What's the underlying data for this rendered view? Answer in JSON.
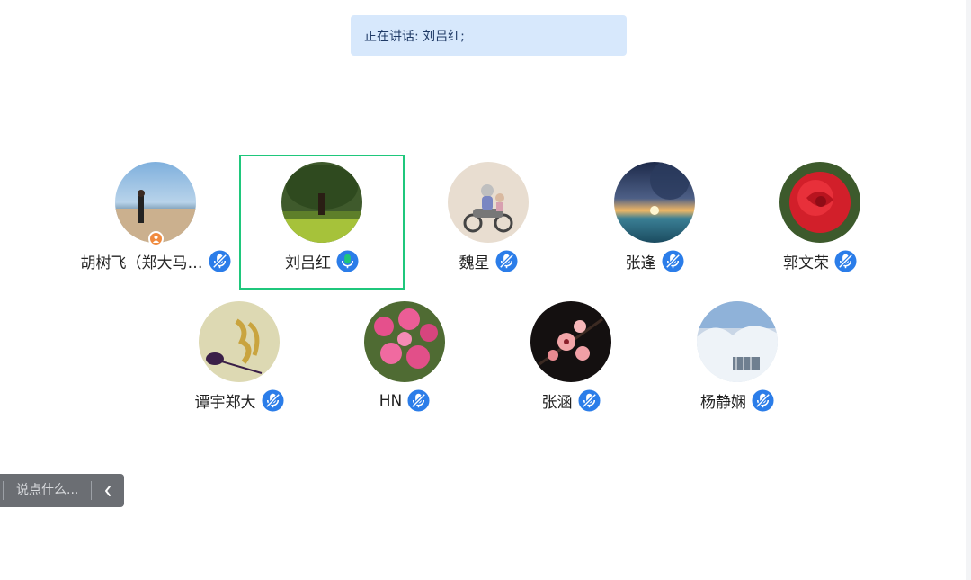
{
  "banner": {
    "text": "正在讲话: 刘吕红;"
  },
  "participants": [
    {
      "name": "胡树飞（郑大马…",
      "avatar": "photo-beach-person-avatar",
      "host": true,
      "active": false,
      "mic_color": "#2b7de9"
    },
    {
      "name": "刘吕红",
      "avatar": "photo-tree-meadow-avatar",
      "host": false,
      "active": true,
      "mic_color": "#1fc77c"
    },
    {
      "name": "魏星",
      "avatar": "cartoon-scooter-avatar",
      "host": false,
      "active": false,
      "mic_color": "#2b7de9"
    },
    {
      "name": "张逢",
      "avatar": "photo-sunset-sea-avatar",
      "host": false,
      "active": false,
      "mic_color": "#2b7de9"
    },
    {
      "name": "郭文荣",
      "avatar": "photo-red-rose-avatar",
      "host": false,
      "active": false,
      "mic_color": "#2b7de9"
    },
    {
      "name": "谭宇郑大",
      "avatar": "calligraphy-avatar",
      "host": false,
      "active": false,
      "mic_color": "#2b7de9"
    },
    {
      "name": "HN",
      "avatar": "photo-pink-flowers-avatar",
      "host": false,
      "active": false,
      "mic_color": "#2b7de9"
    },
    {
      "name": "张涵",
      "avatar": "photo-plum-blossom-avatar",
      "host": false,
      "active": false,
      "mic_color": "#2b7de9"
    },
    {
      "name": "杨静娴",
      "avatar": "photo-snow-scene-avatar",
      "host": false,
      "active": false,
      "mic_color": "#2b7de9"
    }
  ],
  "chat": {
    "placeholder": "说点什么...",
    "collapse_icon": "chevron-left-icon"
  },
  "colors": {
    "active_border": "#1fc77c",
    "banner_bg": "#d7e8fc",
    "mic_blue": "#2b7de9",
    "mic_green": "#1fc77c"
  }
}
